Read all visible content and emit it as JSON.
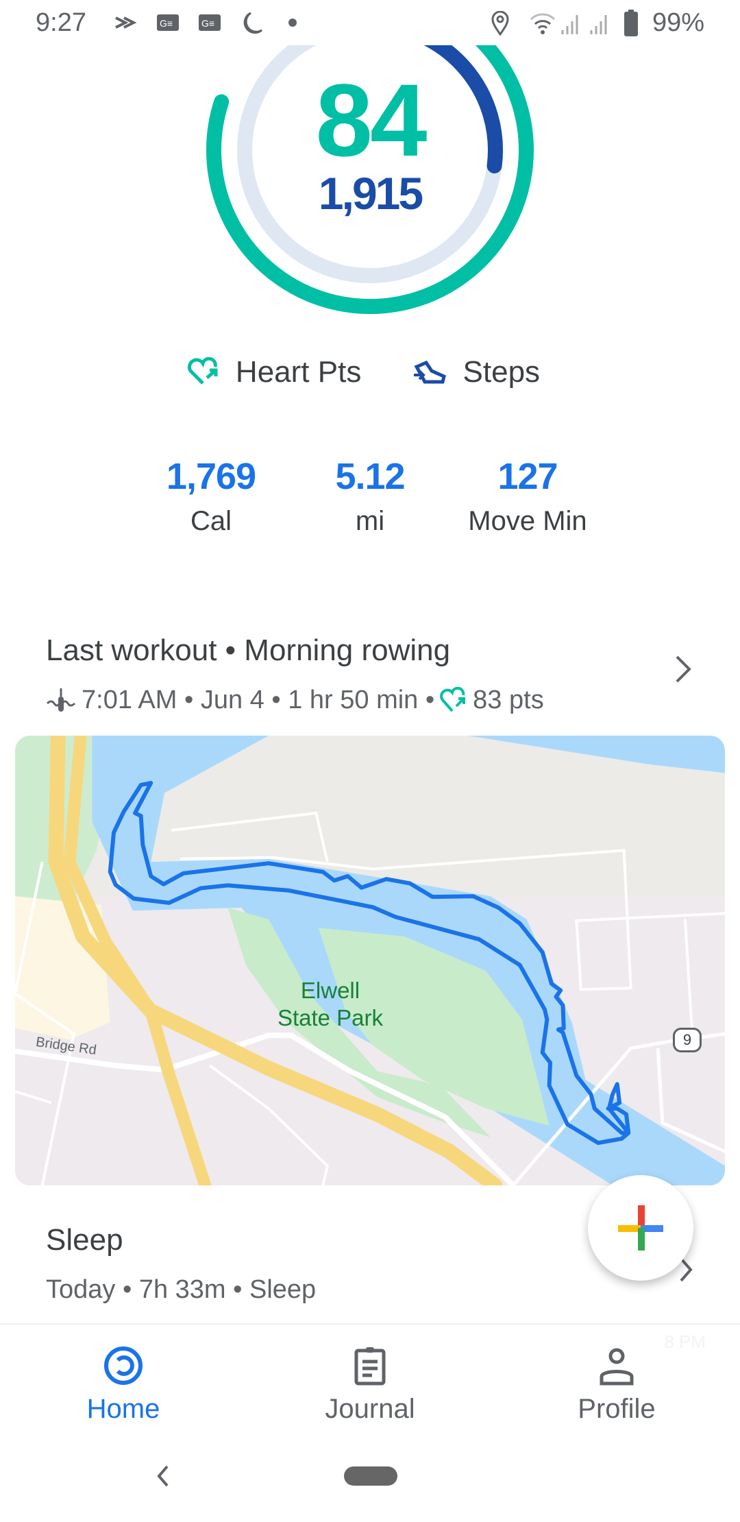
{
  "status_bar": {
    "time": "9:27",
    "battery": "99%",
    "icons": [
      "stream-icon",
      "news-icon",
      "news-icon",
      "do-not-disturb-moon-icon",
      "dot-icon",
      "location-icon",
      "wifi-icon",
      "signal-icon",
      "signal-icon",
      "battery-icon"
    ]
  },
  "ring": {
    "heart_points": "84",
    "steps": "1,915",
    "heart_progress": 0.8,
    "steps_progress": 0.27,
    "colors": {
      "heart": "#00BFA5",
      "steps": "#1A4CA8",
      "track": "#DFE7F2"
    }
  },
  "legend": {
    "heart_label": "Heart Pts",
    "steps_label": "Steps"
  },
  "stats": [
    {
      "value": "1,769",
      "label": "Cal"
    },
    {
      "value": "5.12",
      "label": "mi"
    },
    {
      "value": "127",
      "label": "Move Min"
    }
  ],
  "last_workout": {
    "title": "Last workout • Morning rowing",
    "time": "7:01 AM • Jun 4 • 1 hr 50 min •",
    "points": "83 pts",
    "map": {
      "park_label_1": "Elwell",
      "park_label_2": "State Park",
      "road_label": "Bridge Rd",
      "route_shield": "9"
    }
  },
  "sleep": {
    "title": "Sleep",
    "subtitle": "Today • 7h 33m • Sleep",
    "faded_label": "8 PM"
  },
  "bottom_nav": [
    {
      "label": "Home",
      "active": true
    },
    {
      "label": "Journal",
      "active": false
    },
    {
      "label": "Profile",
      "active": false
    }
  ],
  "accent": "#1A73E8"
}
